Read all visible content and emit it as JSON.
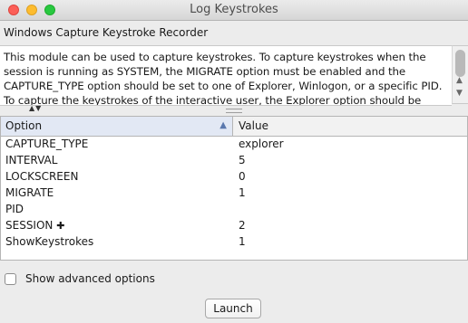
{
  "window": {
    "title": "Log Keystrokes"
  },
  "module": {
    "name": "Windows Capture Keystroke Recorder",
    "description": "This module can be used to capture keystrokes. To capture keystrokes when the\nsession is running as SYSTEM, the MIGRATE option must be enabled and the\nCAPTURE_TYPE option should be set to one of Explorer, Winlogon, or a specific PID.\nTo capture the keystrokes of the interactive user, the Explorer option should be"
  },
  "options_table": {
    "columns": [
      "Option",
      "Value"
    ],
    "sorted_column": "Option",
    "sort_direction": "ascending",
    "rows": [
      {
        "option": "CAPTURE_TYPE",
        "value": "explorer"
      },
      {
        "option": "INTERVAL",
        "value": "5"
      },
      {
        "option": "LOCKSCREEN",
        "value": "0"
      },
      {
        "option": "MIGRATE",
        "value": "1"
      },
      {
        "option": "PID",
        "value": ""
      },
      {
        "option": "SESSION",
        "value": "2",
        "required_marker": "✚"
      },
      {
        "option": "ShowKeystrokes",
        "value": "1"
      }
    ]
  },
  "advanced": {
    "label": "Show advanced options",
    "checked": false
  },
  "actions": {
    "launch_label": "Launch"
  }
}
